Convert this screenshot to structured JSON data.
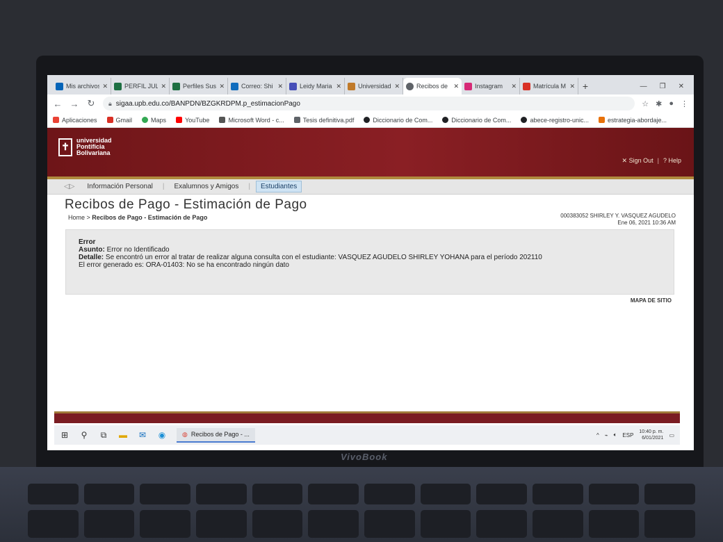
{
  "browser": {
    "tabs": [
      {
        "label": "Mis archivos",
        "color": "#0364b8"
      },
      {
        "label": "PERFIL JULIO",
        "color": "#1d6f42"
      },
      {
        "label": "Perfiles Susi",
        "color": "#1d6f42"
      },
      {
        "label": "Correo: Shi",
        "color": "#0f6cbd"
      },
      {
        "label": "Leidy Maria",
        "color": "#464eb8"
      },
      {
        "label": "Universidad",
        "color": "#c07a2a"
      },
      {
        "label": "Recibos de",
        "color": "#5f6368",
        "active": true
      },
      {
        "label": "Instagram",
        "color": "#d62976"
      },
      {
        "label": "Matrícula M",
        "color": "#d93025"
      }
    ],
    "url": "sigaa.upb.edu.co/BANPDN/BZGKRDPM.p_estimacionPago",
    "bookmarks": [
      {
        "label": "Aplicaciones",
        "color": "#ea4335"
      },
      {
        "label": "Gmail",
        "color": "#d93025"
      },
      {
        "label": "Maps",
        "color": "#34a853"
      },
      {
        "label": "YouTube",
        "color": "#ff0000"
      },
      {
        "label": "Microsoft Word - c...",
        "color": "#555555"
      },
      {
        "label": "Tesis definitiva.pdf",
        "color": "#5f6368"
      },
      {
        "label": "Diccionario de Com...",
        "color": "#202124"
      },
      {
        "label": "Diccionario de Com...",
        "color": "#202124"
      },
      {
        "label": "abece-registro-unic...",
        "color": "#202124"
      },
      {
        "label": "estrategia-abordaje...",
        "color": "#e8710a"
      }
    ]
  },
  "site": {
    "logo_lines": [
      "universidad",
      "Pontificia",
      "Bolivariana"
    ],
    "sign_out": "Sign Out",
    "help": "Help",
    "nav": [
      "Información Personal",
      "Exalumnos y Amigos",
      "Estudiantes"
    ],
    "page_title": "Recibos de Pago - Estimación de Pago",
    "breadcrumb_home": "Home",
    "breadcrumb_current": "Recibos de Pago - Estimación de Pago",
    "user_line": "000383052 SHIRLEY Y. VASQUEZ AGUDELO",
    "date_line": "Ene 06, 2021 10:36 AM",
    "error": {
      "heading": "Error",
      "asunto_label": "Asunto:",
      "asunto_text": "Error no Identificado",
      "detalle_label": "Detalle:",
      "detalle_text": "Se encontró un error al tratar de realizar alguna consulta con el estudiante: VASQUEZ AGUDELO SHIRLEY YOHANA para el período 202110",
      "generated": "El error generado es: ORA-01403: No se ha encontrado ningún dato"
    },
    "sitemap": "MAPA DE SITIO"
  },
  "taskbar": {
    "app_label": "Recibos de Pago - ...",
    "lang": "ESP",
    "time": "10:40 p. m.",
    "date": "6/01/2021"
  }
}
